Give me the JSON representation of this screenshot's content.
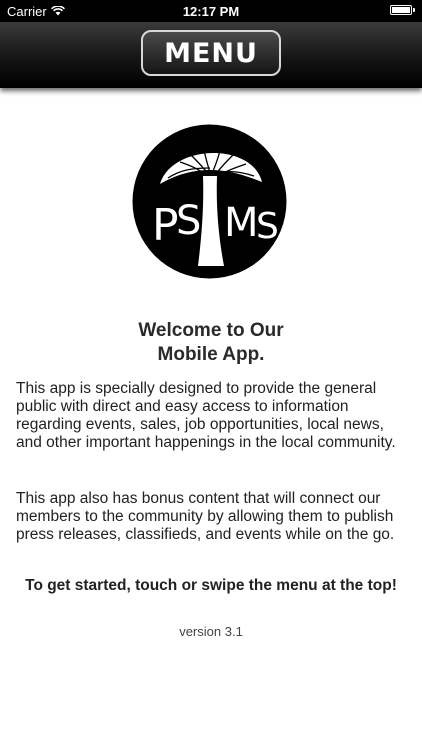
{
  "status_bar": {
    "carrier": "Carrier",
    "time": "12:17 PM",
    "battery_level": 1.0
  },
  "header": {
    "menu_label": "MENU"
  },
  "logo": {
    "text": "PSMS",
    "icon": "mushroom-icon"
  },
  "main": {
    "welcome_line1": "Welcome to Our",
    "welcome_line2": "Mobile App.",
    "paragraph1": "This app is specially designed to provide the general public with direct and easy access to information regarding events, sales, job opportunities, local news, and other important happenings in the local community.",
    "paragraph2": "This app also has bonus content that will connect our members to the community by allowing them to publish press releases, classifieds, and events while on the go.",
    "cta": "To get started, touch or swipe the menu at the top!",
    "version": "version 3.1"
  },
  "colors": {
    "header_bg": "#111111",
    "text": "#222222",
    "background": "#ffffff"
  }
}
